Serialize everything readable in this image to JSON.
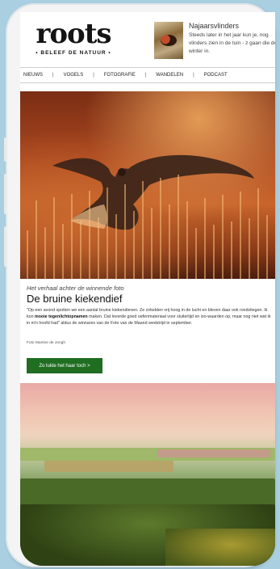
{
  "header": {
    "logo_word": "roots",
    "logo_tagline": "• BELEEF DE NATUUR •",
    "promo": {
      "title": "Najaarsvlinders",
      "text": "Steeds later in het jaar kun je, nog vlinders zien in de tuin - z gaan die de winter in."
    }
  },
  "nav": {
    "items": [
      "NIEUWS",
      "VOGELS",
      "FOTOGRAFIE",
      "WANDELEN",
      "PODCAST"
    ],
    "separator": "|"
  },
  "article": {
    "kicker": "Het verhaal achter de winnende foto",
    "title": "De bruine kiekendief",
    "body_part1": "\"Op een avond spotten we een aantal bruine kiekendieven. Ze cirkelden vrij hoog in de lucht en bleven daar ook rondvliegen. Ik kon ",
    "body_bold": "mooie tegenlichtopnamen",
    "body_part2": " maken. Dat leverde goed oefenmateriaal voor sluitertijd en iso-waarden op, maar nog niet wat ik in m'n hoofd had\" aldus de winnares van de Foto van de Maand wedstrijd in september.",
    "credit": "Foto Martine de Jongh",
    "cta_label": "Zo lukte het haar toch >"
  },
  "colors": {
    "background": "#a9cfe0",
    "cta": "#1f6e21"
  }
}
